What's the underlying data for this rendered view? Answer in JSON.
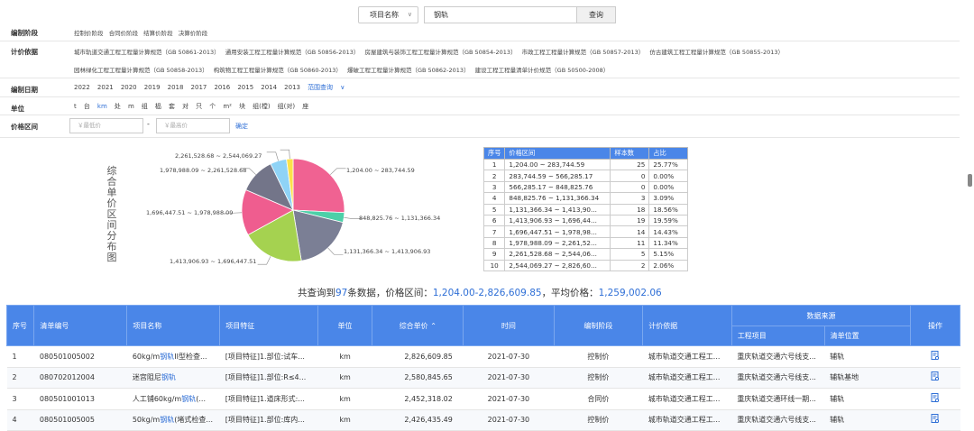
{
  "search": {
    "field": "项目名称",
    "keyword": "钢轨",
    "button": "查询"
  },
  "filters": {
    "stage": {
      "label": "编制阶段",
      "options": [
        "控制价阶段",
        "合同价阶段",
        "结算价阶段",
        "决算价阶段"
      ]
    },
    "basis": {
      "label": "计价依据",
      "options": [
        "城市轨道交通工程工程量计算规范（GB 50861-2013）",
        "通用安装工程工程量计算规范（GB 50856-2013）",
        "房屋建筑与装饰工程工程量计算规范（GB 50854-2013）",
        "市政工程工程量计算规范（GB 50857-2013）",
        "仿古建筑工程工程量计算规范（GB 50855-2013）",
        "园林绿化工程工程量计算规范（GB 50858-2013）",
        "构筑物工程工程量计算规范（GB 50860-2013）",
        "爆破工程工程量计算规范（GB 50862-2013）",
        "建设工程工程量清单计价规范（GB 50500-2008）"
      ]
    },
    "date": {
      "label": "编制日期",
      "years": [
        "2022",
        "2021",
        "2020",
        "2019",
        "2018",
        "2017",
        "2016",
        "2015",
        "2014",
        "2013"
      ],
      "range": "范围查询"
    },
    "unit": {
      "label": "单位",
      "options": [
        "t",
        "台",
        "km",
        "处",
        "m",
        "组",
        "榀",
        "套",
        "对",
        "只",
        "个",
        "m²",
        "块",
        "组(樘)",
        "组(对)",
        "座"
      ]
    },
    "price": {
      "label": "价格区间",
      "min_placeholder": "￥最低价",
      "max_placeholder": "￥最高价",
      "dash": "-",
      "confirm": "确定"
    }
  },
  "chart_data": {
    "type": "pie",
    "title": "综合单价区间分布图",
    "series": [
      {
        "label": "1,204.00 ~ 283,744.59",
        "value": 25,
        "color": "#f06292"
      },
      {
        "label": "283,744.59 ~ 566,285.17",
        "value": 0,
        "color": "#ffb300"
      },
      {
        "label": "566,285.17 ~ 848,825.76",
        "value": 0,
        "color": "#26a69a"
      },
      {
        "label": "848,825.76 ~ 1,131,366.34",
        "value": 3,
        "color": "#4dd0a8"
      },
      {
        "label": "1,131,366.34 ~ 1,413,906.93",
        "value": 18,
        "color": "#7b7f95"
      },
      {
        "label": "1,413,906.93 ~ 1,696,447.51",
        "value": 19,
        "color": "#a5d250"
      },
      {
        "label": "1,696,447.51 ~ 1,978,988.09",
        "value": 14,
        "color": "#ef5d8f"
      },
      {
        "label": "1,978,988.09 ~ 2,261,528.68",
        "value": 11,
        "color": "#737589"
      },
      {
        "label": "2,261,528.68 ~ 2,544,069.27",
        "value": 5,
        "color": "#8fd3f6"
      },
      {
        "label": "2,544,069.27 ~ 2,826,609.85",
        "value": 2,
        "color": "#fbe14a"
      }
    ]
  },
  "dist_table": {
    "headers": [
      "序号",
      "价格区间",
      "样本数",
      "占比"
    ],
    "rows": [
      [
        "1",
        "1,204.00 ~ 283,744.59",
        "25",
        "25.77%"
      ],
      [
        "2",
        "283,744.59 ~ 566,285.17",
        "0",
        "0.00%"
      ],
      [
        "3",
        "566,285.17 ~ 848,825.76",
        "0",
        "0.00%"
      ],
      [
        "4",
        "848,825.76 ~ 1,131,366.34",
        "3",
        "3.09%"
      ],
      [
        "5",
        "1,131,366.34 ~ 1,413,90...",
        "18",
        "18.56%"
      ],
      [
        "6",
        "1,413,906.93 ~ 1,696,44...",
        "19",
        "19.59%"
      ],
      [
        "7",
        "1,696,447.51 ~ 1,978,98...",
        "14",
        "14.43%"
      ],
      [
        "8",
        "1,978,988.09 ~ 2,261,52...",
        "11",
        "11.34%"
      ],
      [
        "9",
        "2,261,528.68 ~ 2,544,06...",
        "5",
        "5.15%"
      ],
      [
        "10",
        "2,544,069.27 ~ 2,826,60...",
        "2",
        "2.06%"
      ]
    ]
  },
  "summary": {
    "prefix": "共查询到",
    "count": "97",
    "mid": "条数据，价格区间：",
    "range": "1,204.00-2,826,609.85",
    "avg_label": "，平均价格：",
    "avg": "1,259,002.06"
  },
  "main_table": {
    "headers": {
      "no": "序号",
      "code": "清单编号",
      "name": "项目名称",
      "feature": "项目特征",
      "unit": "单位",
      "price": "综合单价",
      "sort": "⌃",
      "time": "时间",
      "stage": "编制阶段",
      "basis": "计价依据",
      "source": "数据来源",
      "project": "工程项目",
      "location": "清单位置",
      "op": "操作"
    },
    "rows": [
      {
        "no": "1",
        "code": "080501005002",
        "name_pre": "60kg/m",
        "name_hl": "钢轨",
        "name_post": "II型检查...",
        "feature": "[项目特征]1.部位:试车...",
        "unit": "km",
        "price": "2,826,609.85",
        "time": "2021-07-30",
        "stage": "控制价",
        "basis": "城市轨道交通工程工...",
        "project": "重庆轨道交通六号线支...",
        "location": "辅轨"
      },
      {
        "no": "2",
        "code": "080702012004",
        "name_pre": "迷宫阻尼",
        "name_hl": "钢轨",
        "name_post": "",
        "feature": "[项目特征]1.部位:R≤4...",
        "unit": "km",
        "price": "2,580,845.65",
        "time": "2021-07-30",
        "stage": "控制价",
        "basis": "城市轨道交通工程工...",
        "project": "重庆轨道交通六号线支...",
        "location": "辅轨基地"
      },
      {
        "no": "3",
        "code": "080501001013",
        "name_pre": "人工铺60kg/m",
        "name_hl": "钢轨",
        "name_post": "(...",
        "feature": "[项目特征]1.道床形式:...",
        "unit": "km",
        "price": "2,452,318.02",
        "time": "2021-07-30",
        "stage": "合同价",
        "basis": "城市轨道交通工程工...",
        "project": "重庆轨道交通环线一期...",
        "location": "辅轨"
      },
      {
        "no": "4",
        "code": "080501005005",
        "name_pre": "50kg/m",
        "name_hl": "钢轨",
        "name_post": "(堵式检查...",
        "feature": "[项目特征]1.部位:库内...",
        "unit": "km",
        "price": "2,426,435.49",
        "time": "2021-07-30",
        "stage": "控制价",
        "basis": "城市轨道交通工程工...",
        "project": "重庆轨道交通六号线支...",
        "location": "辅轨"
      }
    ]
  }
}
